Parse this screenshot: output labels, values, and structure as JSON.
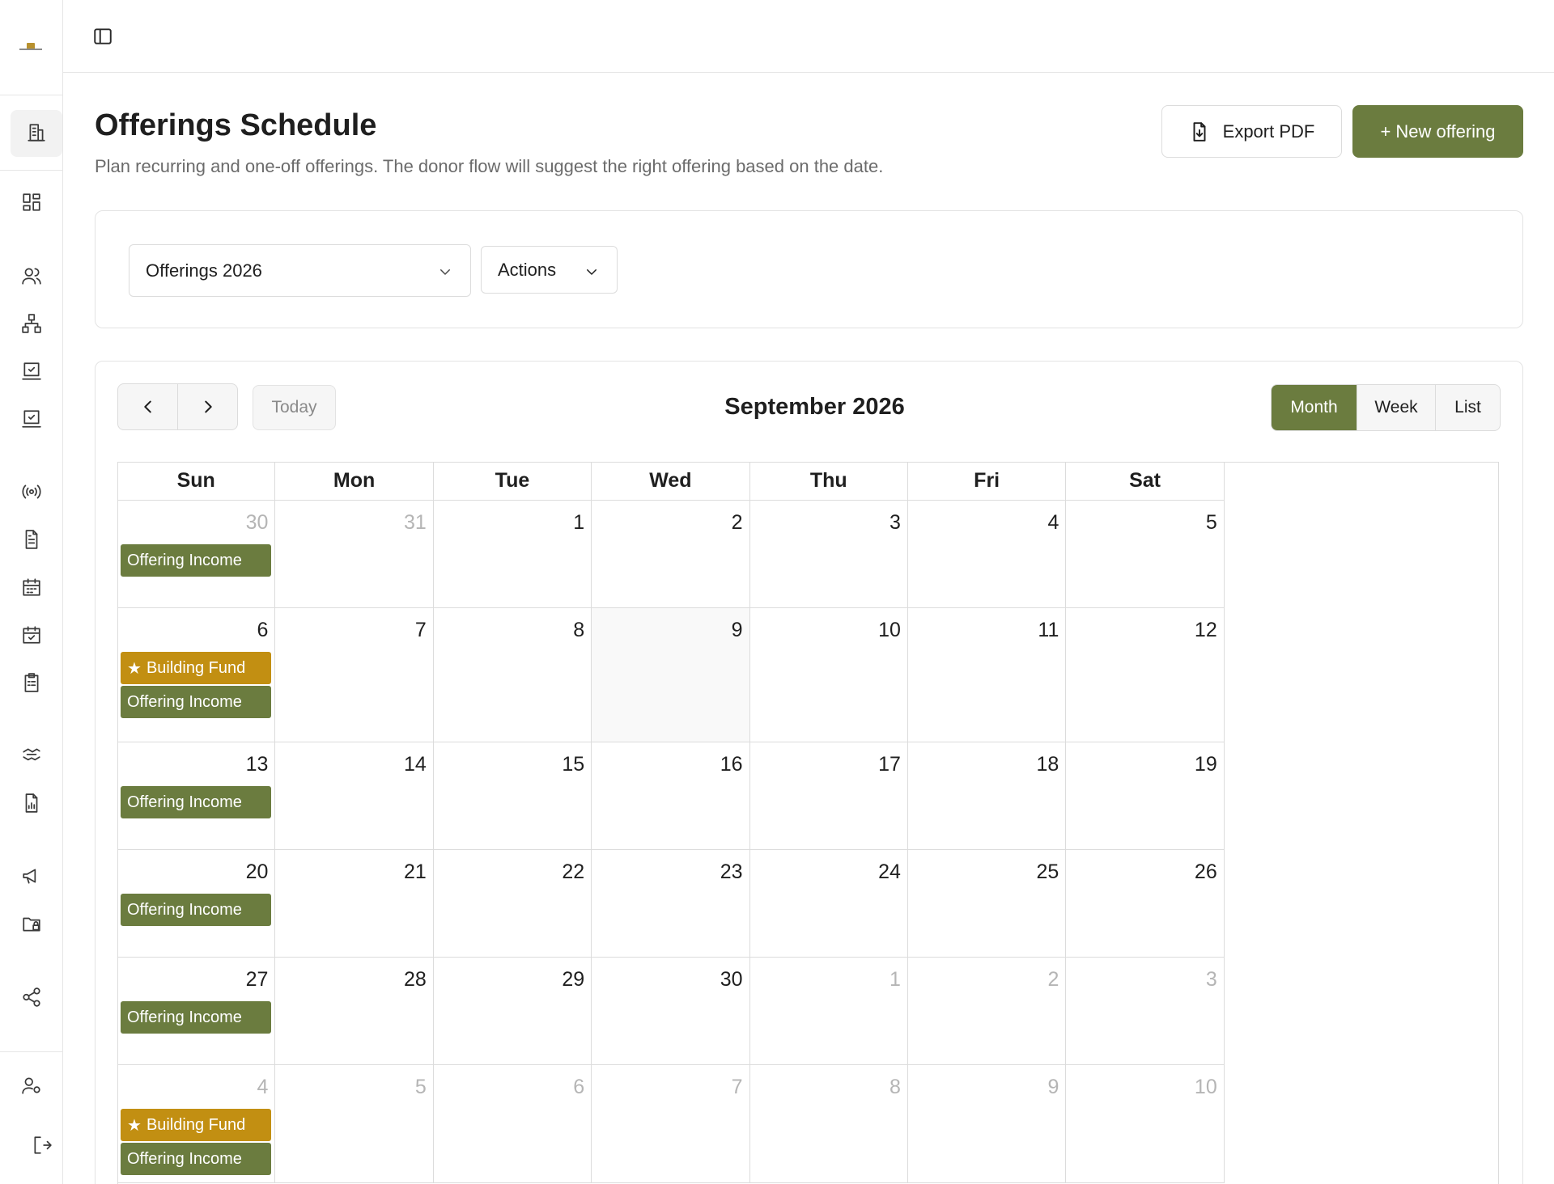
{
  "sidebar": {
    "icons": [
      "building-icon",
      "dashboard-icon",
      "users-icon",
      "org-chart-icon",
      "board-check-icon",
      "board-check-icon-2",
      "broadcast-icon",
      "document-icon",
      "calendar-icon",
      "calendar-check-icon",
      "clipboard-icon",
      "handshake-icon",
      "report-icon",
      "megaphone-icon",
      "folder-lock-icon",
      "share-icon",
      "user-settings-icon",
      "logout-icon"
    ]
  },
  "header": {
    "title": "Offerings Schedule",
    "subtitle": "Plan recurring and one-off offerings. The donor flow will suggest the right offering based on the date.",
    "export_label": "Export PDF",
    "new_label": "+ New offering"
  },
  "filters": {
    "schedule_select": "Offerings 2026",
    "actions_label": "Actions"
  },
  "calendar": {
    "today_label": "Today",
    "month_title": "September 2026",
    "views": [
      {
        "label": "Month",
        "active": true
      },
      {
        "label": "Week",
        "active": false
      },
      {
        "label": "List",
        "active": false
      }
    ],
    "weekdays": [
      "Sun",
      "Mon",
      "Tue",
      "Wed",
      "Thu",
      "Fri",
      "Sat"
    ],
    "weeks": [
      [
        {
          "num": "30",
          "other": true,
          "events": [
            {
              "label": "Offering Income",
              "kind": "green"
            }
          ]
        },
        {
          "num": "31",
          "other": true,
          "events": []
        },
        {
          "num": "1",
          "events": []
        },
        {
          "num": "2",
          "events": []
        },
        {
          "num": "3",
          "events": []
        },
        {
          "num": "4",
          "events": []
        },
        {
          "num": "5",
          "events": []
        }
      ],
      [
        {
          "num": "6",
          "events": [
            {
              "label": "Building Fund",
              "kind": "gold",
              "star": true
            },
            {
              "label": "Offering Income",
              "kind": "green"
            }
          ]
        },
        {
          "num": "7",
          "events": []
        },
        {
          "num": "8",
          "events": []
        },
        {
          "num": "9",
          "today": true,
          "events": []
        },
        {
          "num": "10",
          "events": []
        },
        {
          "num": "11",
          "events": []
        },
        {
          "num": "12",
          "events": []
        }
      ],
      [
        {
          "num": "13",
          "events": [
            {
              "label": "Offering Income",
              "kind": "green"
            }
          ]
        },
        {
          "num": "14",
          "events": []
        },
        {
          "num": "15",
          "events": []
        },
        {
          "num": "16",
          "events": []
        },
        {
          "num": "17",
          "events": []
        },
        {
          "num": "18",
          "events": []
        },
        {
          "num": "19",
          "events": []
        }
      ],
      [
        {
          "num": "20",
          "events": [
            {
              "label": "Offering Income",
              "kind": "green"
            }
          ]
        },
        {
          "num": "21",
          "events": []
        },
        {
          "num": "22",
          "events": []
        },
        {
          "num": "23",
          "events": []
        },
        {
          "num": "24",
          "events": []
        },
        {
          "num": "25",
          "events": []
        },
        {
          "num": "26",
          "events": []
        }
      ],
      [
        {
          "num": "27",
          "events": [
            {
              "label": "Offering Income",
              "kind": "green"
            }
          ]
        },
        {
          "num": "28",
          "events": []
        },
        {
          "num": "29",
          "events": []
        },
        {
          "num": "30",
          "events": []
        },
        {
          "num": "1",
          "other": true,
          "events": []
        },
        {
          "num": "2",
          "other": true,
          "events": []
        },
        {
          "num": "3",
          "other": true,
          "events": []
        }
      ],
      [
        {
          "num": "4",
          "other": true,
          "events": [
            {
              "label": "Building Fund",
              "kind": "gold",
              "star": true
            },
            {
              "label": "Offering Income",
              "kind": "green"
            }
          ]
        },
        {
          "num": "5",
          "other": true,
          "events": []
        },
        {
          "num": "6",
          "other": true,
          "events": []
        },
        {
          "num": "7",
          "other": true,
          "events": []
        },
        {
          "num": "8",
          "other": true,
          "events": []
        },
        {
          "num": "9",
          "other": true,
          "events": []
        },
        {
          "num": "10",
          "other": true,
          "events": []
        }
      ]
    ]
  },
  "colors": {
    "accent": "#6b7c3f",
    "gold": "#c28f12"
  }
}
